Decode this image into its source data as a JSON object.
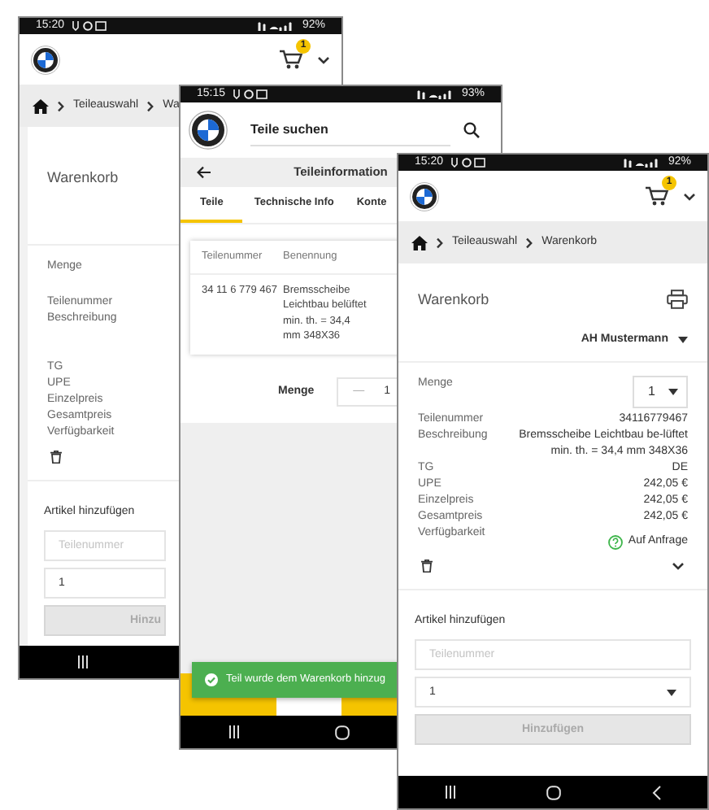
{
  "screens": [
    {
      "kind": "cart",
      "status_bar": {
        "time": "15:20",
        "battery": "92%"
      },
      "cart_count": "1",
      "breadcrumb": [
        "Teileauswahl",
        "Wa"
      ],
      "title": "Warenkorb",
      "fields": [
        {
          "kind": "select",
          "label": "Menge"
        },
        {
          "kind": "text",
          "label": "Teilenummer"
        },
        {
          "kind": "text",
          "label": "Beschreibung"
        },
        {
          "kind": "text",
          "label": "TG"
        },
        {
          "kind": "text",
          "label": "UPE"
        },
        {
          "kind": "text",
          "label": "Einzelpreis"
        },
        {
          "kind": "text",
          "label": "Gesamtpreis"
        },
        {
          "kind": "availability",
          "label": "Verfügbarkeit"
        }
      ],
      "add_section": {
        "title": "Artikel hinzufügen",
        "placeholder": "Teilenummer",
        "quantity": "1",
        "button": "Hinzu",
        "disabled": true
      }
    },
    {
      "kind": "parts",
      "status_bar": {
        "time": "15:15",
        "battery": "93%"
      },
      "search": {
        "value": "Teile suchen"
      },
      "title": "Teileinformation",
      "tabs": [
        {
          "label": "Teile",
          "selected": true
        },
        {
          "label": "Technische Info",
          "selected": false
        },
        {
          "label": "Konte",
          "selected": false
        }
      ],
      "table": {
        "columns": [
          "Teilenummer",
          "Benennung"
        ],
        "rows": [
          [
            "34 11 6 779 467",
            "Bremsscheibe Leichtbau belüftet min. th. = 34,4 mm 348X36"
          ]
        ]
      },
      "quantity": {
        "label": "Menge",
        "minus": "—",
        "value": "1"
      },
      "toast": "Teil wurde dem Warenkorb hinzug"
    },
    {
      "kind": "cart",
      "status_bar": {
        "time": "15:20",
        "battery": "92%"
      },
      "cart_count": "1",
      "breadcrumb": [
        "Teileauswahl",
        "Warenkorb"
      ],
      "title": "Warenkorb",
      "dealer": "AH Mustermann",
      "fields": [
        {
          "kind": "select",
          "label": "Menge",
          "value": "1"
        },
        {
          "kind": "text",
          "label": "Teilenummer",
          "value": "34116779467"
        },
        {
          "kind": "text",
          "label": "Beschreibung",
          "value": "Bremsscheibe Leichtbau be-lüftet min. th. = 34,4 mm 348X36"
        },
        {
          "kind": "text",
          "label": "TG",
          "value": "DE"
        },
        {
          "kind": "text",
          "label": "UPE",
          "value": "242,05 €"
        },
        {
          "kind": "text",
          "label": "Einzelpreis",
          "value": "242,05 €"
        },
        {
          "kind": "text",
          "label": "Gesamtpreis",
          "value": "242,05 €"
        },
        {
          "kind": "availability",
          "label": "Verfügbarkeit",
          "value": "Auf Anfrage"
        }
      ],
      "add_section": {
        "title": "Artikel hinzufügen",
        "placeholder": "Teilenummer",
        "quantity": "1",
        "button": "Hinzufügen",
        "disabled": true
      }
    }
  ]
}
